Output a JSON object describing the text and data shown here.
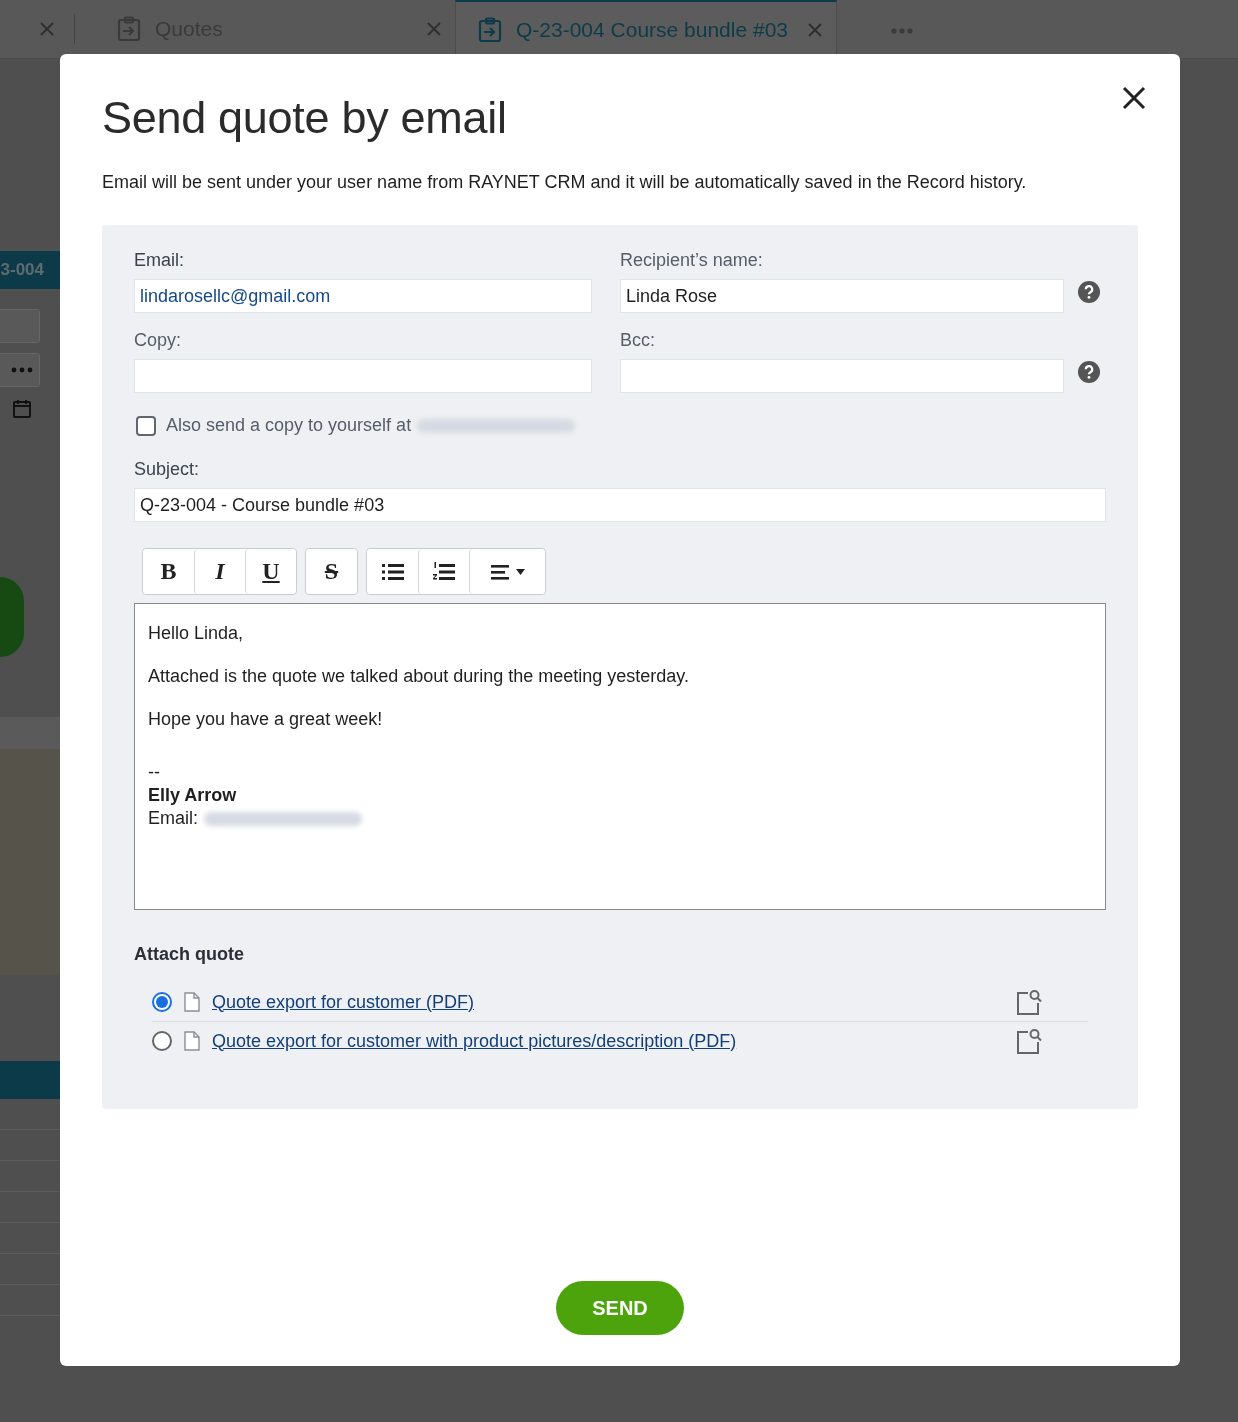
{
  "background": {
    "tabs": [
      {
        "label": "Quotes",
        "selected": false
      },
      {
        "label": "Q-23-004 Course bundle #03",
        "selected": true
      }
    ],
    "record_code": "3-004"
  },
  "dialog": {
    "title": "Send quote by email",
    "description": "Email will be sent under your user name from RAYNET CRM and it will be automatically saved in the Record history.",
    "fields": [
      {
        "kind": "email",
        "label": "Email:",
        "value": "lindarosellc@gmail.com",
        "required": true
      },
      {
        "kind": "text",
        "label": "Recipient’s name:",
        "value": "Linda Rose",
        "required": false,
        "help": true
      },
      {
        "kind": "email",
        "label": "Copy:",
        "required": false
      },
      {
        "kind": "email",
        "label": "Bcc:",
        "required": false,
        "help": true
      }
    ],
    "copy_to_self": {
      "label": "Also send a copy to yourself at",
      "checked": false
    },
    "subject": {
      "label": "Subject:",
      "value": "Q-23-004 - Course bundle #03",
      "required": true
    },
    "toolbar": [
      [
        {
          "kind": "bold",
          "label": "B"
        },
        {
          "kind": "italic",
          "label": "I"
        },
        {
          "kind": "underline",
          "label": "U"
        }
      ],
      [
        {
          "kind": "strike",
          "label": "S"
        }
      ],
      [
        {
          "kind": "bullet-list"
        },
        {
          "kind": "numbered-list"
        },
        {
          "kind": "align"
        }
      ]
    ],
    "body": [
      "Hello Linda,",
      "Attached is the quote we talked about during the meeting yesterday.",
      "Hope you have a great week!"
    ],
    "signature": {
      "separator": "--",
      "name": "Elly Arrow",
      "email_label": "Email:"
    },
    "attach": {
      "title": "Attach quote",
      "options": [
        {
          "label": "Quote export for customer (PDF)",
          "selected": true
        },
        {
          "label": "Quote export for customer with product pictures/description (PDF)",
          "selected": false
        }
      ]
    },
    "send_button": "SEND"
  }
}
